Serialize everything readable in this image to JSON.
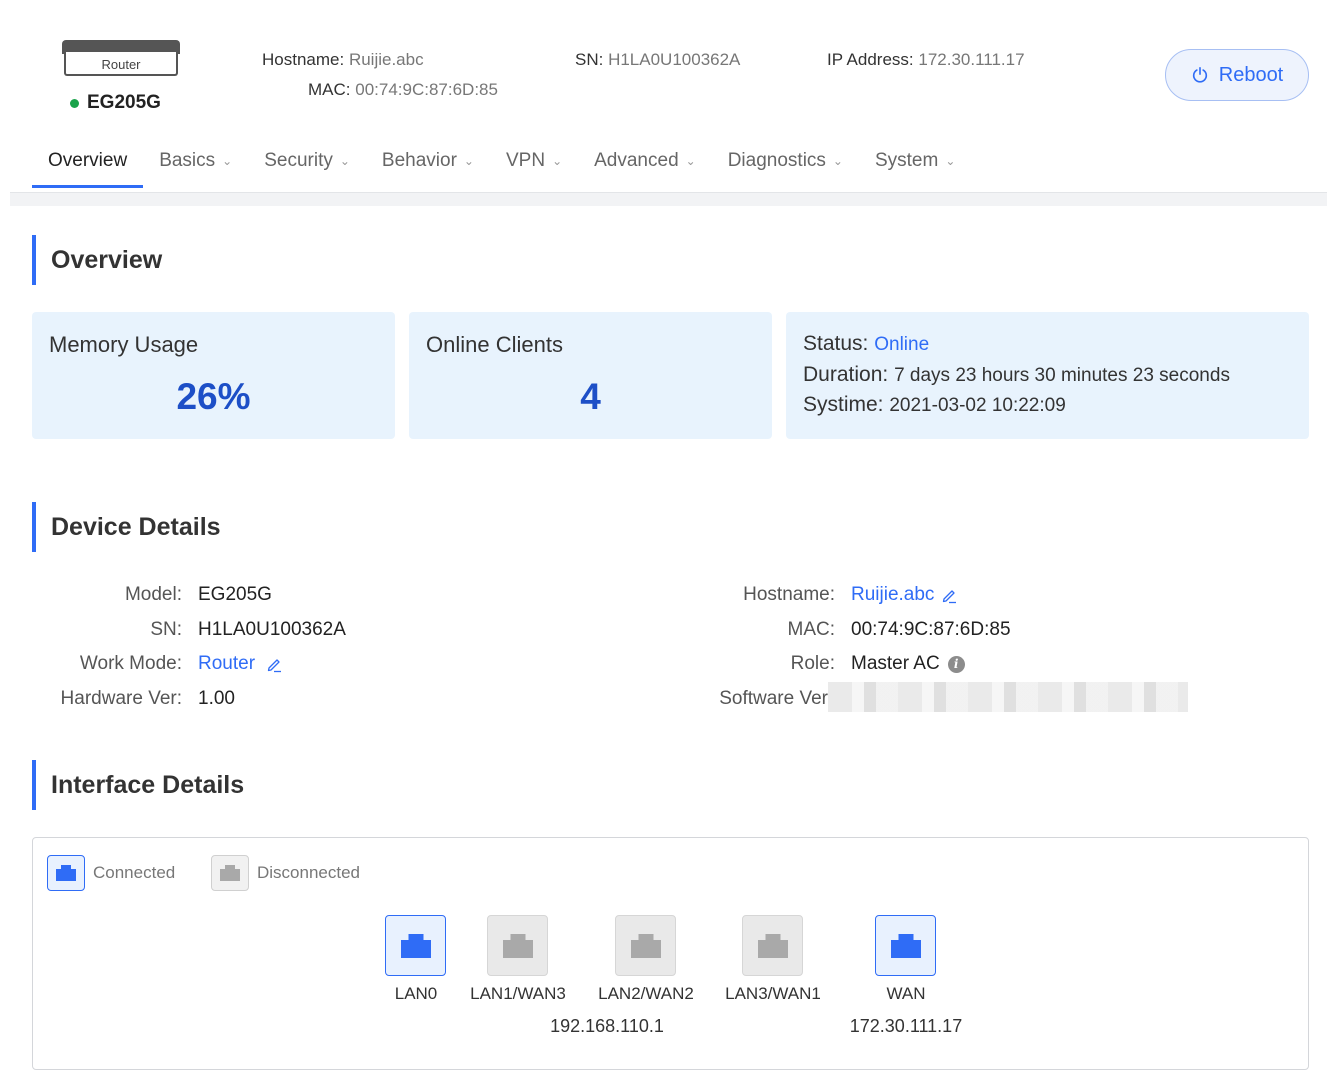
{
  "header": {
    "device_image_label": "Router",
    "model": "EG205G",
    "status_color": "#1aa34a",
    "hostname_label": "Hostname:",
    "hostname_value": "Ruijie.abc",
    "mac_label": "MAC:",
    "mac_value": "00:74:9C:87:6D:85",
    "sn_label": "SN:",
    "sn_value": "H1LA0U100362A",
    "ip_label": "IP Address:",
    "ip_value": "172.30.111.17",
    "reboot_label": "Reboot"
  },
  "nav": {
    "tabs": [
      {
        "label": "Overview",
        "active": true
      },
      {
        "label": "Basics"
      },
      {
        "label": "Security"
      },
      {
        "label": "Behavior"
      },
      {
        "label": "VPN"
      },
      {
        "label": "Advanced"
      },
      {
        "label": "Diagnostics"
      },
      {
        "label": "System"
      }
    ]
  },
  "overview": {
    "title": "Overview",
    "memory_label": "Memory Usage",
    "memory_value": "26%",
    "clients_label": "Online Clients",
    "clients_value": "4",
    "status_label": "Status:",
    "status_value": "Online",
    "duration_label": "Duration:",
    "duration_value": "7 days 23 hours 30 minutes 23 seconds",
    "systime_label": "Systime:",
    "systime_value": "2021-03-02 10:22:09"
  },
  "device_details": {
    "title": "Device Details",
    "model_label": "Model:",
    "model_value": "EG205G",
    "sn_label": "SN:",
    "sn_value": "H1LA0U100362A",
    "workmode_label": "Work Mode:",
    "workmode_value": "Router",
    "hwver_label": "Hardware Ver:",
    "hwver_value": "1.00",
    "hostname_label": "Hostname:",
    "hostname_value": "Ruijie.abc",
    "mac_label": "MAC:",
    "mac_value": "00:74:9C:87:6D:85",
    "role_label": "Role:",
    "role_value": "Master AC",
    "swver_label": "Software Ver"
  },
  "interface_details": {
    "title": "Interface Details",
    "legend_connected": "Connected",
    "legend_disconnected": "Disconnected",
    "ports": [
      {
        "name": "LAN0",
        "connected": true
      },
      {
        "name": "LAN1/WAN3",
        "connected": false
      },
      {
        "name": "LAN2/WAN2",
        "connected": false
      },
      {
        "name": "LAN3/WAN1",
        "connected": false
      },
      {
        "name": "WAN",
        "connected": true
      }
    ],
    "lan_ip": "192.168.110.1",
    "wan_ip": "172.30.111.17"
  },
  "colors": {
    "accent": "#2f6cf6",
    "card_bg": "#e8f3fd",
    "big_number": "#1d4fc7",
    "port_disconnected": "#a9a9a9"
  }
}
